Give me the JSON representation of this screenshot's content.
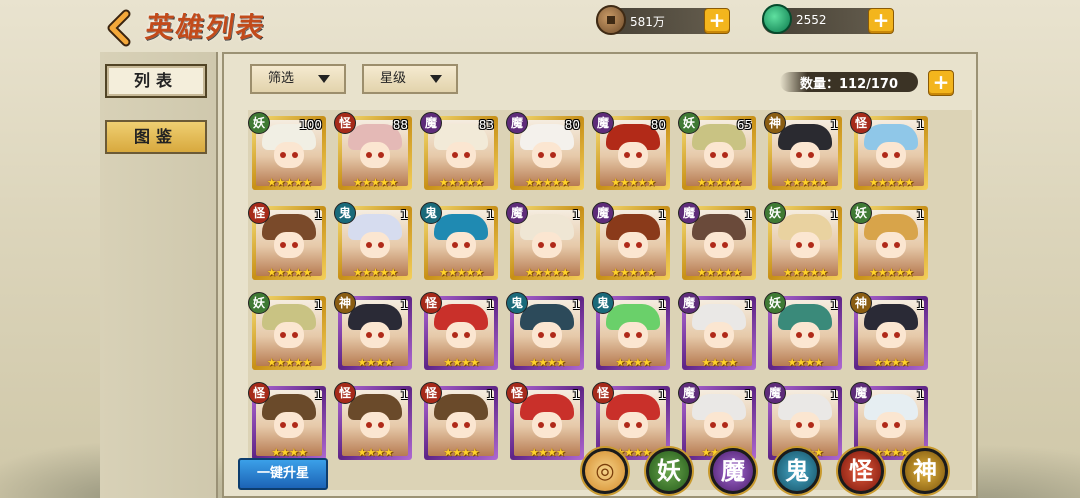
{
  "header": {
    "back_icon": "chevron-left-icon",
    "title": "英雄列表"
  },
  "currency": {
    "coins": {
      "icon": "copper-coin-icon",
      "value": "581万",
      "plus": "+"
    },
    "jade": {
      "icon": "jade-icon",
      "value": "2552",
      "plus": "+"
    }
  },
  "sidebar": {
    "items": [
      {
        "label": "列表",
        "active": true
      },
      {
        "label": "图鉴",
        "active": false
      }
    ]
  },
  "toolbar": {
    "filter_label": "筛选",
    "star_label": "星级",
    "count_label": "数量：112/170",
    "plus": "+"
  },
  "heroes": [
    {
      "faction": "妖",
      "level": "100",
      "frame": "gold",
      "stars": "★★★★★",
      "hair": "#f1efe4"
    },
    {
      "faction": "怪",
      "level": "88",
      "frame": "gold",
      "stars": "★★★★★",
      "hair": "#e4b9b6"
    },
    {
      "faction": "魔",
      "level": "83",
      "frame": "gold",
      "stars": "★★★★★",
      "hair": "#f2ead8"
    },
    {
      "faction": "魔",
      "level": "80",
      "frame": "gold",
      "stars": "★★★★★",
      "hair": "#f4f1ec"
    },
    {
      "faction": "魔",
      "level": "80",
      "frame": "gold",
      "stars": "★★★★★",
      "hair": "#b22a18"
    },
    {
      "faction": "妖",
      "level": "65",
      "frame": "gold",
      "stars": "★★★★★",
      "hair": "#c9c383"
    },
    {
      "faction": "神",
      "level": "1",
      "frame": "gold",
      "stars": "★★★★★",
      "hair": "#2a2a30"
    },
    {
      "faction": "怪",
      "level": "1",
      "frame": "gold",
      "stars": "★★★★★",
      "hair": "#8fc7e8"
    },
    {
      "faction": "怪",
      "level": "1",
      "frame": "gold",
      "stars": "★★★★★",
      "hair": "#7a4a2a"
    },
    {
      "faction": "鬼",
      "level": "1",
      "frame": "gold",
      "stars": "★★★★★",
      "hair": "#d6dcef"
    },
    {
      "faction": "鬼",
      "level": "1",
      "frame": "gold",
      "stars": "★★★★★",
      "hair": "#1f8ab2"
    },
    {
      "faction": "魔",
      "level": "1",
      "frame": "gold",
      "stars": "★★★★★",
      "hair": "#efe6d4"
    },
    {
      "faction": "魔",
      "level": "1",
      "frame": "gold",
      "stars": "★★★★★",
      "hair": "#8a3a1a"
    },
    {
      "faction": "魔",
      "level": "1",
      "frame": "gold",
      "stars": "★★★★★",
      "hair": "#6a4a3a"
    },
    {
      "faction": "妖",
      "level": "1",
      "frame": "gold",
      "stars": "★★★★★",
      "hair": "#e9d2a0"
    },
    {
      "faction": "妖",
      "level": "1",
      "frame": "gold",
      "stars": "★★★★★",
      "hair": "#d8a44a"
    },
    {
      "faction": "妖",
      "level": "1",
      "frame": "gold",
      "stars": "★★★★★",
      "hair": "#c9c383"
    },
    {
      "faction": "神",
      "level": "1",
      "frame": "purple",
      "stars": "★★★★",
      "hair": "#2a2a36"
    },
    {
      "faction": "怪",
      "level": "1",
      "frame": "purple",
      "stars": "★★★★",
      "hair": "#c9302a"
    },
    {
      "faction": "鬼",
      "level": "1",
      "frame": "purple",
      "stars": "★★★★",
      "hair": "#2c4a5a"
    },
    {
      "faction": "鬼",
      "level": "1",
      "frame": "purple",
      "stars": "★★★★",
      "hair": "#6ad06a"
    },
    {
      "faction": "魔",
      "level": "1",
      "frame": "purple",
      "stars": "★★★★",
      "hair": "#eae8e6"
    },
    {
      "faction": "妖",
      "level": "1",
      "frame": "purple",
      "stars": "★★★★",
      "hair": "#3a8a7a"
    },
    {
      "faction": "神",
      "level": "1",
      "frame": "purple",
      "stars": "★★★★",
      "hair": "#2a2a36"
    },
    {
      "faction": "怪",
      "level": "1",
      "frame": "purple",
      "stars": "★★★★",
      "hair": "#6a4a2a"
    },
    {
      "faction": "怪",
      "level": "1",
      "frame": "purple",
      "stars": "★★★★",
      "hair": "#6a4a2a"
    },
    {
      "faction": "怪",
      "level": "1",
      "frame": "purple",
      "stars": "★★★★",
      "hair": "#6a4a2a"
    },
    {
      "faction": "怪",
      "level": "1",
      "frame": "purple",
      "stars": "★★★★",
      "hair": "#c9302a"
    },
    {
      "faction": "怪",
      "level": "1",
      "frame": "purple",
      "stars": "★★★★",
      "hair": "#c9302a"
    },
    {
      "faction": "魔",
      "level": "1",
      "frame": "purple",
      "stars": "★★★★",
      "hair": "#eae8e6"
    },
    {
      "faction": "魔",
      "level": "1",
      "frame": "purple",
      "stars": "★★★★",
      "hair": "#eae8e6"
    },
    {
      "faction": "魔",
      "level": "1",
      "frame": "purple",
      "stars": "★★★★",
      "hair": "#e6eef2"
    }
  ],
  "footer": {
    "upgrade_label": "一键升星",
    "factions": [
      {
        "key": "all",
        "label": "◎",
        "icon": "all-factions-icon"
      },
      {
        "key": "yao",
        "label": "妖"
      },
      {
        "key": "mo",
        "label": "魔"
      },
      {
        "key": "gui",
        "label": "鬼"
      },
      {
        "key": "guai",
        "label": "怪"
      },
      {
        "key": "shen",
        "label": "神"
      }
    ]
  }
}
